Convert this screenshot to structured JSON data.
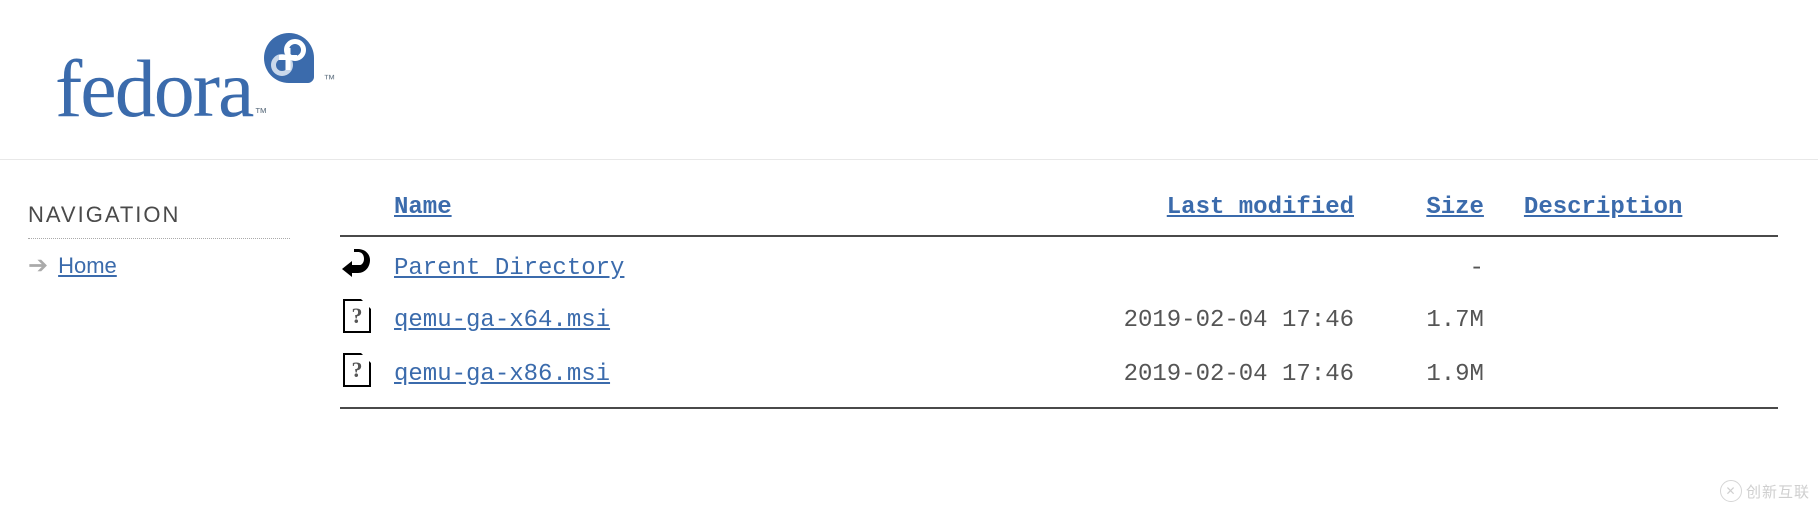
{
  "brand": {
    "name": "fedora"
  },
  "sidebar": {
    "title": "NAVIGATION",
    "items": [
      {
        "label": "Home"
      }
    ]
  },
  "listing": {
    "columns": {
      "name": "Name",
      "last_modified": "Last modified",
      "size": "Size",
      "description": "Description"
    },
    "parent": {
      "label": "Parent Directory",
      "size": "-"
    },
    "rows": [
      {
        "name": "qemu-ga-x64.msi",
        "last_modified": "2019-02-04 17:46",
        "size": "1.7M",
        "description": ""
      },
      {
        "name": "qemu-ga-x86.msi",
        "last_modified": "2019-02-04 17:46",
        "size": "1.9M",
        "description": ""
      }
    ]
  },
  "watermark": "创新互联"
}
